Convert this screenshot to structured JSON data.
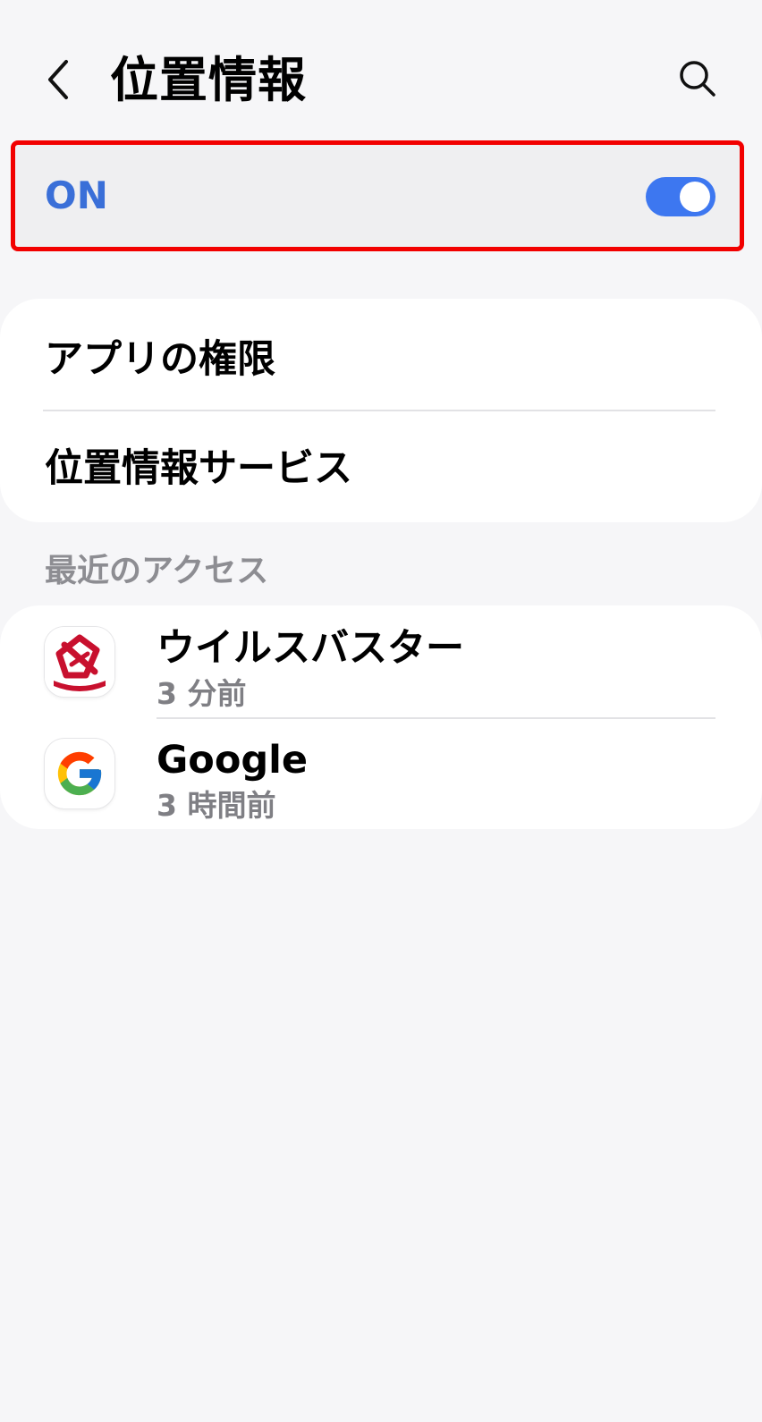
{
  "header": {
    "title": "位置情報",
    "back_icon": "chevron-left-icon",
    "search_icon": "search-icon"
  },
  "location_toggle": {
    "label": "ON",
    "state": true,
    "accent_color": "#3d77f0",
    "highlight_color": "#f20000"
  },
  "menu": {
    "items": [
      {
        "label": "アプリの権限"
      },
      {
        "label": "位置情報サービス"
      }
    ]
  },
  "recent_access": {
    "header": "最近のアクセス",
    "apps": [
      {
        "name": "ウイルスバスター",
        "time": "3 分前",
        "icon": "virusbuster-app-icon"
      },
      {
        "name": "Google",
        "time": "3 時間前",
        "icon": "google-app-icon"
      }
    ]
  }
}
